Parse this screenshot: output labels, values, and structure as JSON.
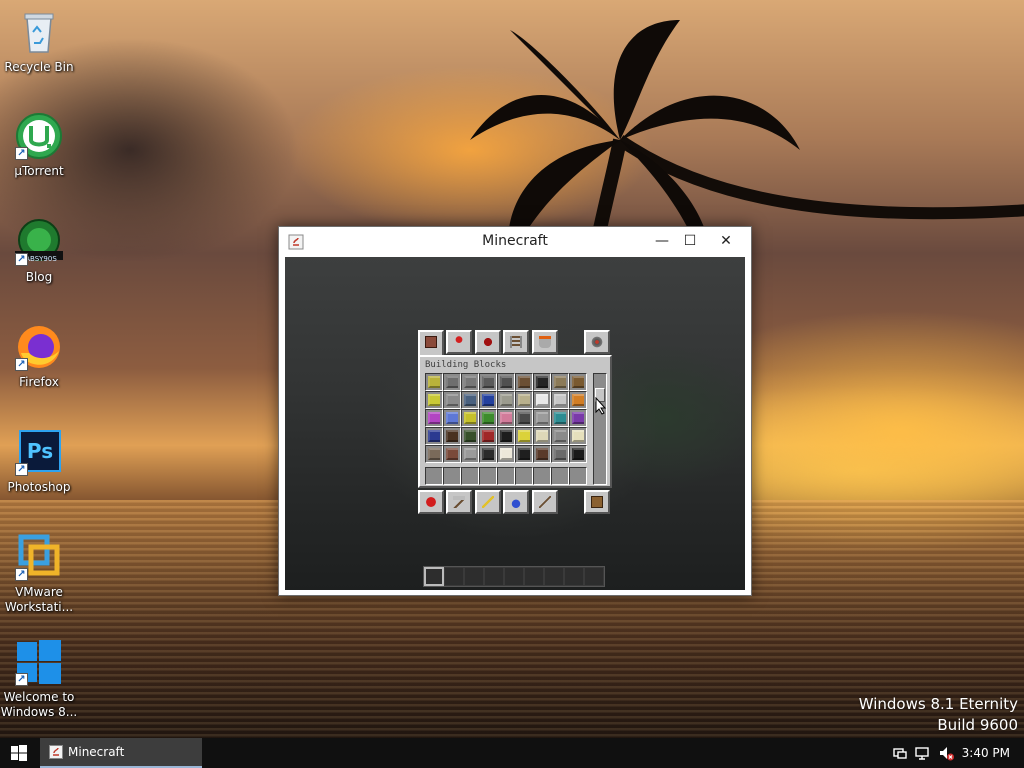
{
  "desktop": {
    "icons": [
      {
        "label": "Recycle Bin",
        "icon": "recycle-bin-icon"
      },
      {
        "label": "µTorrent",
        "icon": "utorrent-icon"
      },
      {
        "label": "Blog",
        "icon": "blog-icon"
      },
      {
        "label": "Firefox",
        "icon": "firefox-icon"
      },
      {
        "label": "Photoshop",
        "icon": "photoshop-icon"
      },
      {
        "label": "VMware Workstati...",
        "icon": "vmware-icon"
      },
      {
        "label": "Welcome to Windows 8...",
        "icon": "windows-icon"
      }
    ],
    "blog_logo_text": "LABSY90S",
    "photoshop_logo_text": "Ps",
    "watermark_line1": "Windows 8.1 Eternity",
    "watermark_line2": "Build 9600"
  },
  "window": {
    "title": "Minecraft",
    "minimize_glyph": "—",
    "maximize_glyph": "☐",
    "close_glyph": "✕"
  },
  "inventory": {
    "tab_title": "Building Blocks",
    "top_tabs": [
      "building-blocks-tab",
      "decoration-tab",
      "redstone-tab",
      "transportation-tab",
      "misc-tab",
      "search-tab"
    ],
    "bottom_tabs": [
      "foodstuffs-tab",
      "tools-tab",
      "combat-tab",
      "brewing-tab",
      "materials-tab",
      "survival-inventory-tab"
    ],
    "block_colors": [
      [
        "#b9b23a",
        "#6e6e6e",
        "#777",
        "#5a5a5a",
        "#505050",
        "#6b4f33",
        "#252525",
        "#8b7a58",
        "#7a5a30"
      ],
      [
        "#c9c935",
        "#8a8a8a",
        "#49607e",
        "#23409e",
        "#9b9b8e",
        "#b8b08c",
        "#e8e8e8",
        "#c7c7c7",
        "#d27e25"
      ],
      [
        "#b245c2",
        "#5e78d6",
        "#c5c02a",
        "#3c8c2c",
        "#d27b9a",
        "#4a4a4a",
        "#9b9b9b",
        "#2d8c92",
        "#7a3aa9"
      ],
      [
        "#2b3a90",
        "#4a3220",
        "#37502a",
        "#a02828",
        "#1d1d1d",
        "#dbd23a",
        "#ded7b8",
        "#8a8a8a",
        "#e6e0bc"
      ],
      [
        "#7a6a5a",
        "#7a4a3a",
        "#9a9a9a",
        "#2a2a2a",
        "#ede8d9",
        "#1f1f1f",
        "#5a3a2a",
        "#6a6a6a",
        "#1a1a1a"
      ]
    ]
  },
  "taskbar": {
    "task_label": "Minecraft",
    "clock": "3:40 PM"
  },
  "colors": {
    "taskbar": "#101010",
    "accent": "#9ab6d6",
    "mc_panel": "#c6c6c6"
  }
}
